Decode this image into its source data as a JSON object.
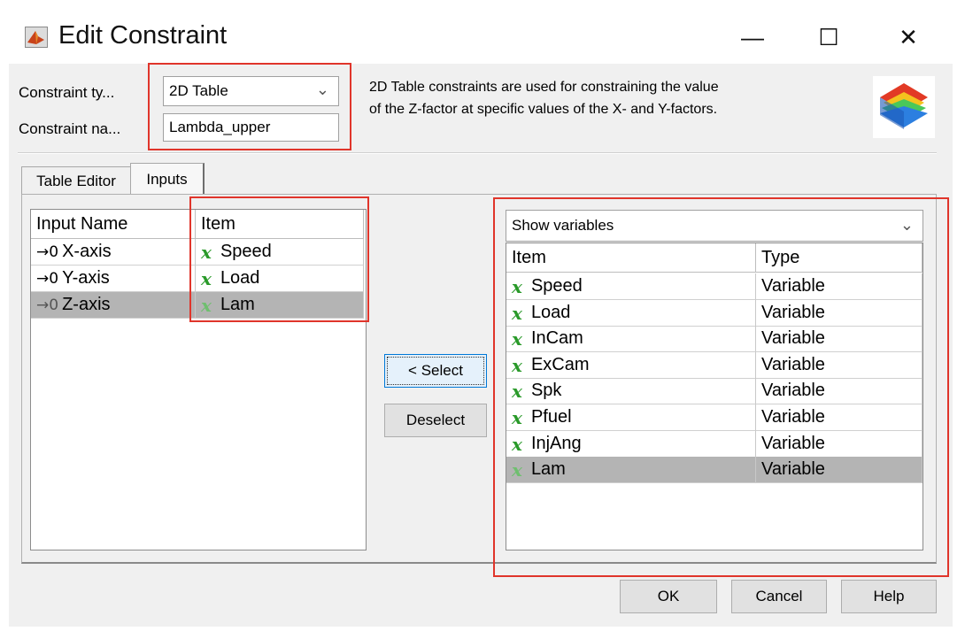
{
  "window": {
    "title": "Edit Constraint",
    "minimize": "—",
    "maximize": "☐",
    "close": "✕"
  },
  "form": {
    "type_label": "Constraint ty...",
    "type_value": "2D Table",
    "name_label": "Constraint na...",
    "name_value": "Lambda_upper",
    "description_line1": "2D Table constraints are used for constraining the value",
    "description_line2": "of the Z-factor at specific values of the X- and Y-factors."
  },
  "tabs": [
    "Table Editor",
    "Inputs"
  ],
  "inputs_table": {
    "headers": [
      "Input Name",
      "Item"
    ],
    "rows": [
      {
        "name": "X-axis",
        "item": "Speed"
      },
      {
        "name": "Y-axis",
        "item": "Load"
      },
      {
        "name": "Z-axis",
        "item": "Lam"
      }
    ]
  },
  "buttons": {
    "select": "< Select",
    "deselect": "Deselect",
    "ok": "OK",
    "cancel": "Cancel",
    "help": "Help"
  },
  "variables": {
    "filter_value": "Show variables",
    "headers": [
      "Item",
      "Type"
    ],
    "rows": [
      {
        "item": "Speed",
        "type": "Variable"
      },
      {
        "item": "Load",
        "type": "Variable"
      },
      {
        "item": "InCam",
        "type": "Variable"
      },
      {
        "item": "ExCam",
        "type": "Variable"
      },
      {
        "item": "Spk",
        "type": "Variable"
      },
      {
        "item": "Pfuel",
        "type": "Variable"
      },
      {
        "item": "InjAng",
        "type": "Variable"
      },
      {
        "item": "Lam",
        "type": "Variable"
      }
    ]
  },
  "icons": {
    "variable_glyph": "x",
    "input_glyph": "→0",
    "chevron": "⌄"
  },
  "colors": {
    "highlight": "#e0352b",
    "selected_row": "#b4b4b4",
    "variable_icon": "#2a9a2a"
  }
}
